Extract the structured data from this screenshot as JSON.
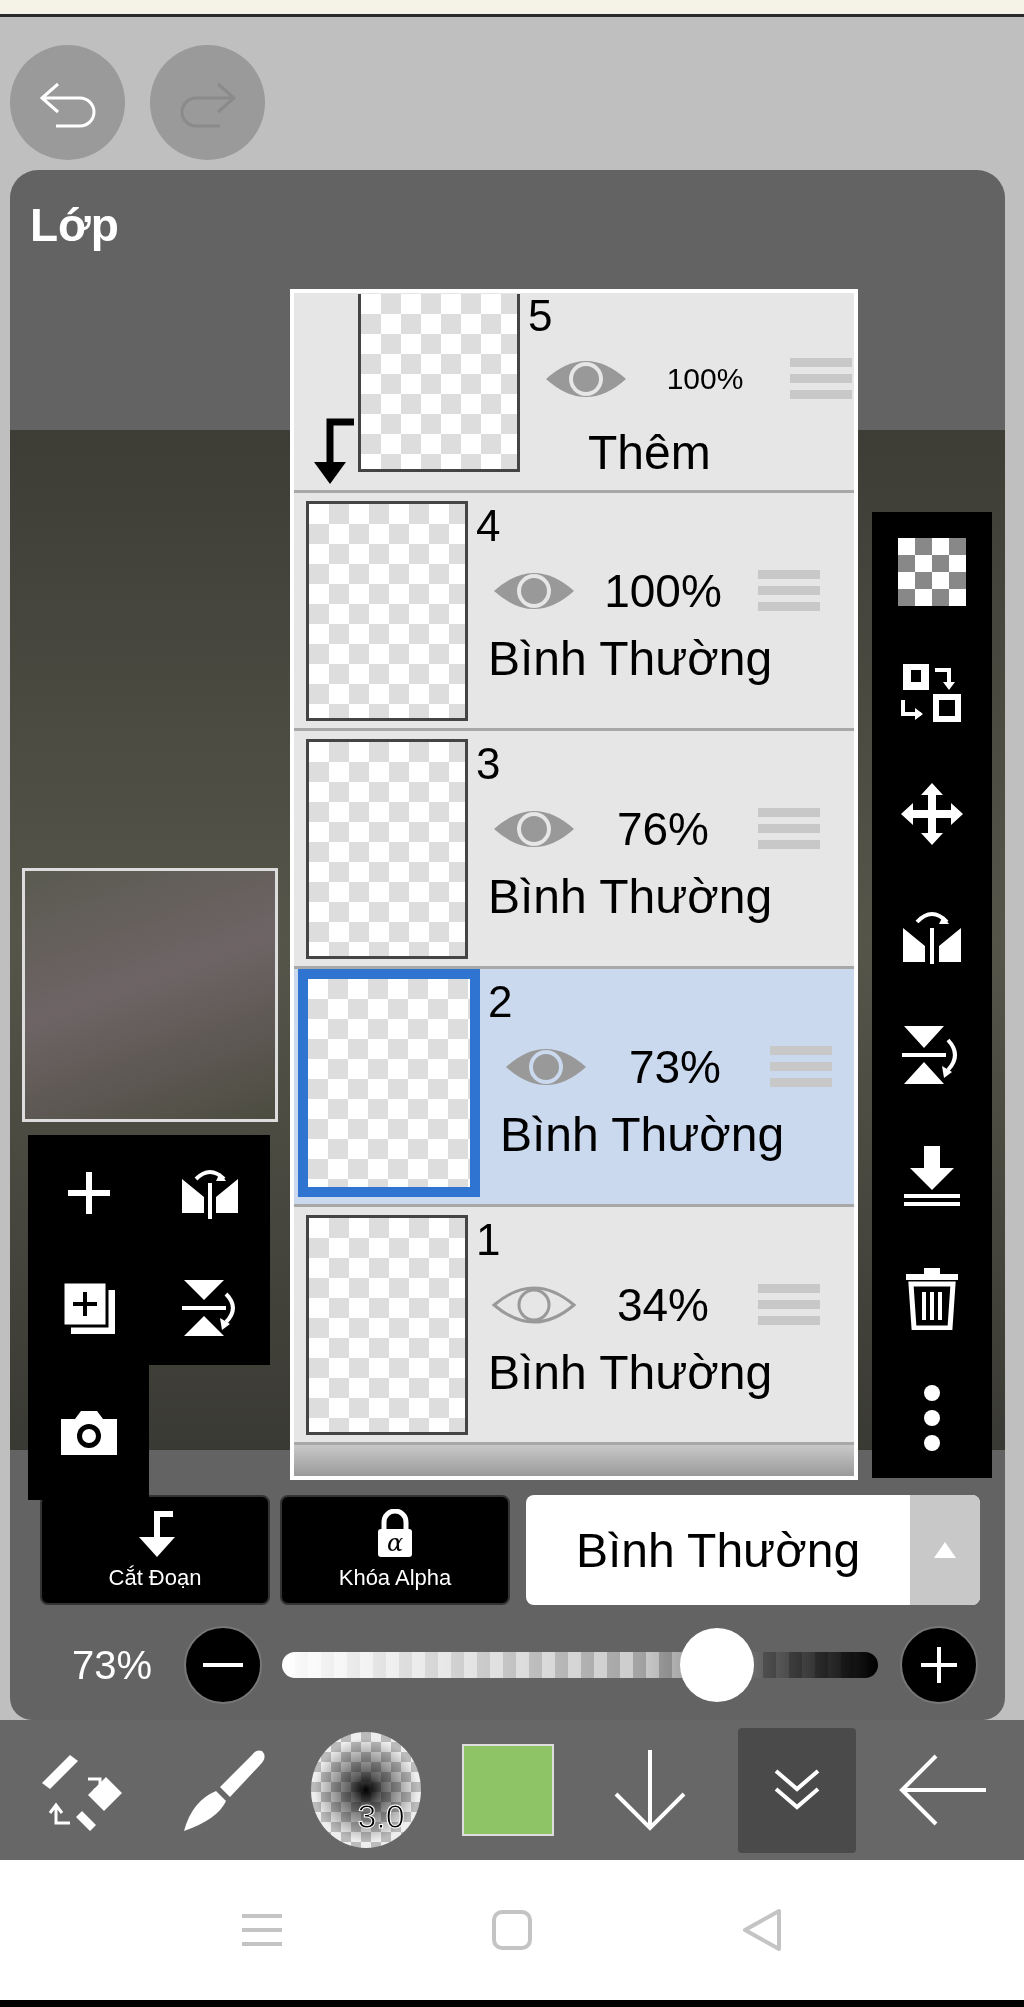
{
  "panel": {
    "title": "Lớp"
  },
  "layers": [
    {
      "number": "5",
      "opacity": "100%",
      "mode": "Thêm",
      "visible": true,
      "selected": false,
      "clipping": true
    },
    {
      "number": "4",
      "opacity": "100%",
      "mode": "Bình Thường",
      "visible": true,
      "selected": false,
      "clipping": false
    },
    {
      "number": "3",
      "opacity": "76%",
      "mode": "Bình Thường",
      "visible": true,
      "selected": false,
      "clipping": false
    },
    {
      "number": "2",
      "opacity": "73%",
      "mode": "Bình Thường",
      "visible": true,
      "selected": true,
      "clipping": false
    },
    {
      "number": "1",
      "opacity": "34%",
      "mode": "Bình Thường",
      "visible": false,
      "selected": false,
      "clipping": false
    }
  ],
  "layer_buttons": [
    {
      "label": "Cắt Đoạn",
      "kind": "clipping"
    },
    {
      "label": "Khóa Alpha",
      "kind": "alpha-lock",
      "glyph": "α"
    }
  ],
  "blend_mode": {
    "value": "Bình Thường"
  },
  "opacity": {
    "reading": "73%",
    "level": 0.73
  },
  "toolbar": {
    "brush_size": "3.0"
  }
}
